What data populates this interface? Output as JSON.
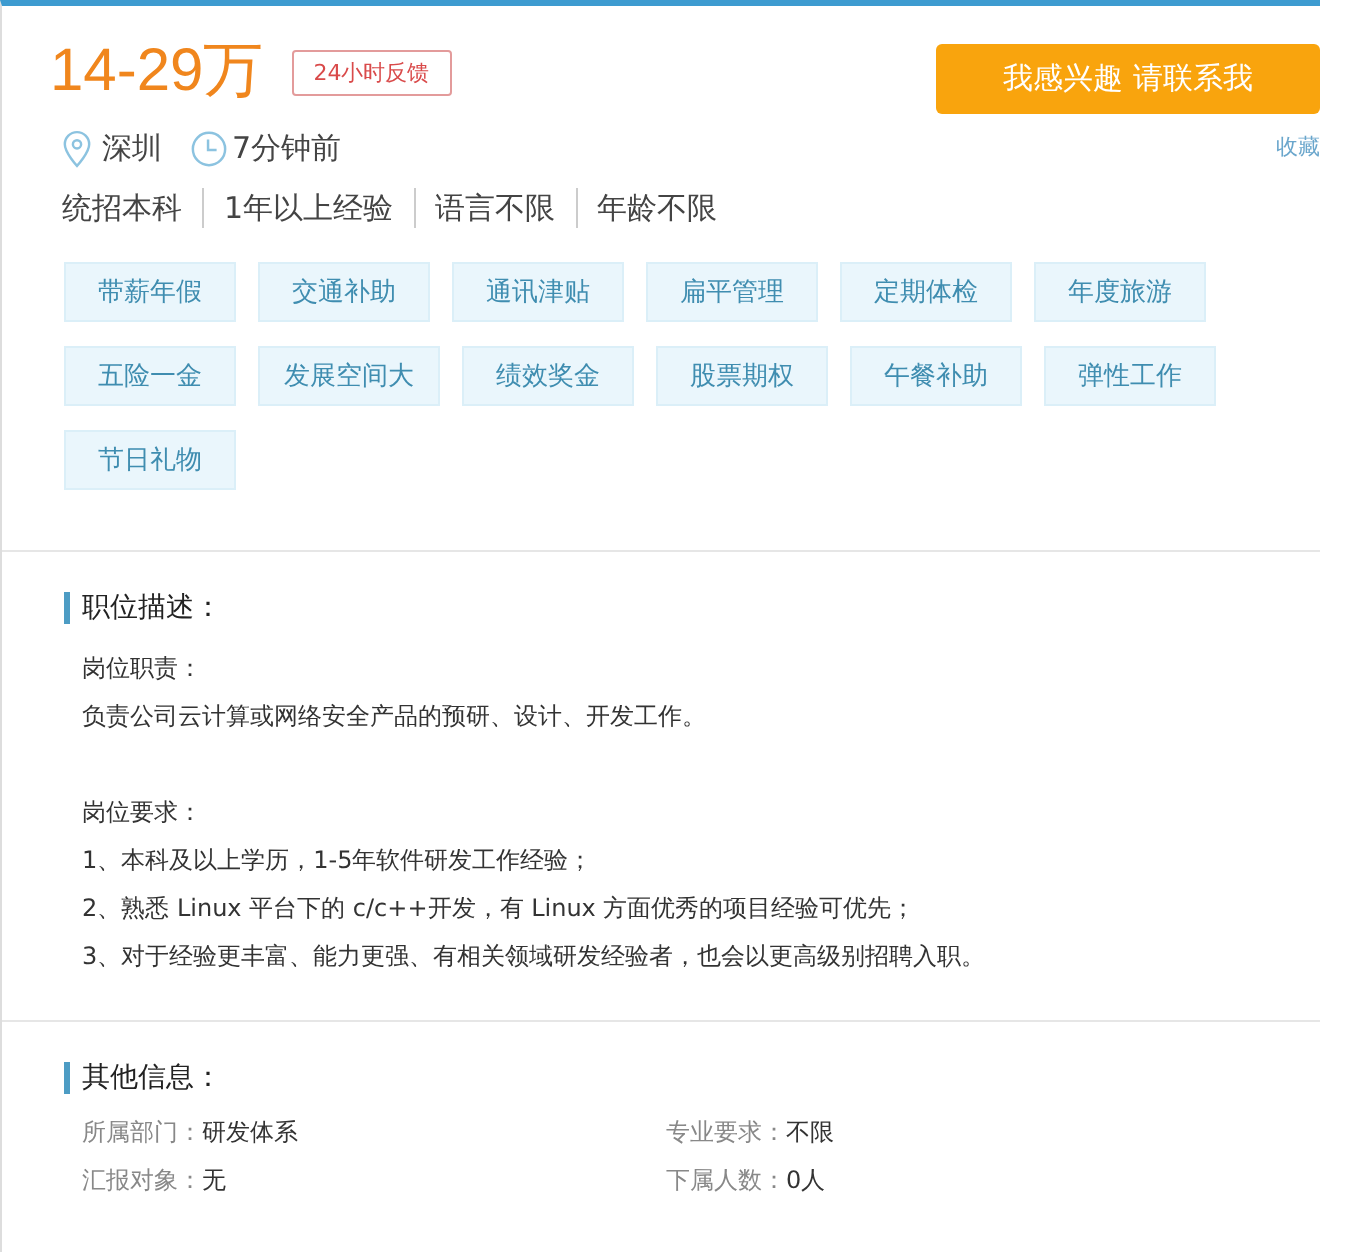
{
  "header": {
    "salary": "14-29万",
    "badge": "24小时反馈",
    "apply_button": "我感兴趣 请联系我",
    "favorite_link": "收藏",
    "location": "深圳",
    "posted": "7分钟前",
    "requirements": [
      "统招本科",
      "1年以上经验",
      "语言不限",
      "年龄不限"
    ]
  },
  "benefits": [
    "带薪年假",
    "交通补助",
    "通讯津贴",
    "扁平管理",
    "定期体检",
    "年度旅游",
    "五险一金",
    "发展空间大",
    "绩效奖金",
    "股票期权",
    "午餐补助",
    "弹性工作",
    "节日礼物"
  ],
  "description": {
    "title": "职位描述：",
    "paragraphs": [
      [
        "岗位职责：",
        "负责公司云计算或网络安全产品的预研、设计、开发工作。"
      ],
      [
        "岗位要求：",
        "1、本科及以上学历，1-5年软件研发工作经验；",
        "2、熟悉 Linux 平台下的 c/c++开发，有 Linux 方面优秀的项目经验可优先；",
        "3、对于经验更丰富、能力更强、有相关领域研发经验者，也会以更高级别招聘入职。"
      ]
    ]
  },
  "other_info": {
    "title": "其他信息：",
    "fields": [
      {
        "label": "所属部门：",
        "value": "研发体系"
      },
      {
        "label": "专业要求：",
        "value": "不限"
      },
      {
        "label": "汇报对象：",
        "value": "无"
      },
      {
        "label": "下属人数：",
        "value": "0人"
      }
    ]
  }
}
